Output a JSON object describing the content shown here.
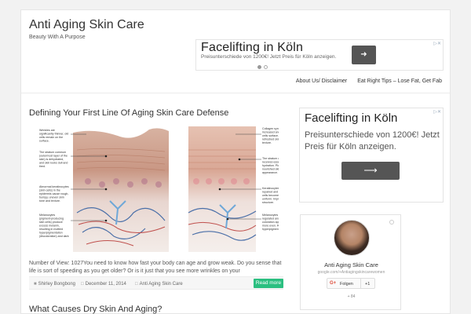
{
  "header": {
    "site_title": "Anti Aging Skin Care",
    "site_description": "Beauty With A Purpose"
  },
  "ad_top": {
    "title": "Facelifting in Köln",
    "subtitle": "Preisunterschiede von 1200€! Jetzt Preis für Köln anzeigen.",
    "button_icon": "arrow-right-icon",
    "choices": "▷✕"
  },
  "nav": {
    "items": [
      {
        "label": "About Us/ Disclaimer"
      },
      {
        "label": "Eat Right Tips – Lose Fat, Get Fab"
      }
    ]
  },
  "post": {
    "title": "Defining Your First Line Of Aging Skin Care Defense",
    "excerpt": "Number of View: 1027You need to know how fast your body can age and grow weak. Do you sense that life is sort of speeding as you get older? Or is it just that you see more wrinkles on your",
    "meta": {
      "author": "Shirley Bongbong",
      "date": "December 11, 2014",
      "category": "Anti Aging Skin Care",
      "read_more": "Read more"
    },
    "image_labels_left": [
      "Wrinkles are significantly thinner, old cells remain on the surface.",
      "The stratum corneum (outermost layer of the skin) is dehydrated, and skin looks dull and tired.",
      "Abnormal keratinocytes (skin cells) in the epidermis cause rough, bumpy, uneven skin tone and texture.",
      "Melanocytes (pigment-producing skin cells) produce excess melanin, resulting in mottled hyperpigmentation (discoloration) and dark"
    ],
    "image_labels_right": [
      "Collagen synthesis is increased and new cells surface. Even, refreshed skin tone and texture.",
      "The stratum corneum receives essential hydration. Plump, nourished skin appearance.",
      "Keratinocytes are repaired and epidermal cells become more uniform. Improved skin structure.",
      "Melanocytes are regulated and skin coloration appears more even. Reduced hyperpigmentation."
    ]
  },
  "post2": {
    "title": "What Causes Dry Skin And Aging?"
  },
  "ad_side": {
    "title": "Facelifting in Köln",
    "subtitle": "Preisunterschiede von 1200€! Jetzt Preis für Köln anzeigen.",
    "button_icon": "arrow-right-icon",
    "choices": "▷✕"
  },
  "gplus": {
    "name": "Anti Aging Skin Care",
    "url": "google.com/+Antiagingskincarewomen",
    "follow": "Folgen",
    "plus_one": "+1",
    "count": "+ 84"
  },
  "colors": {
    "accent": "#2bbf80",
    "background": "#f2f2f2",
    "gplus_red": "#dd4b39"
  }
}
